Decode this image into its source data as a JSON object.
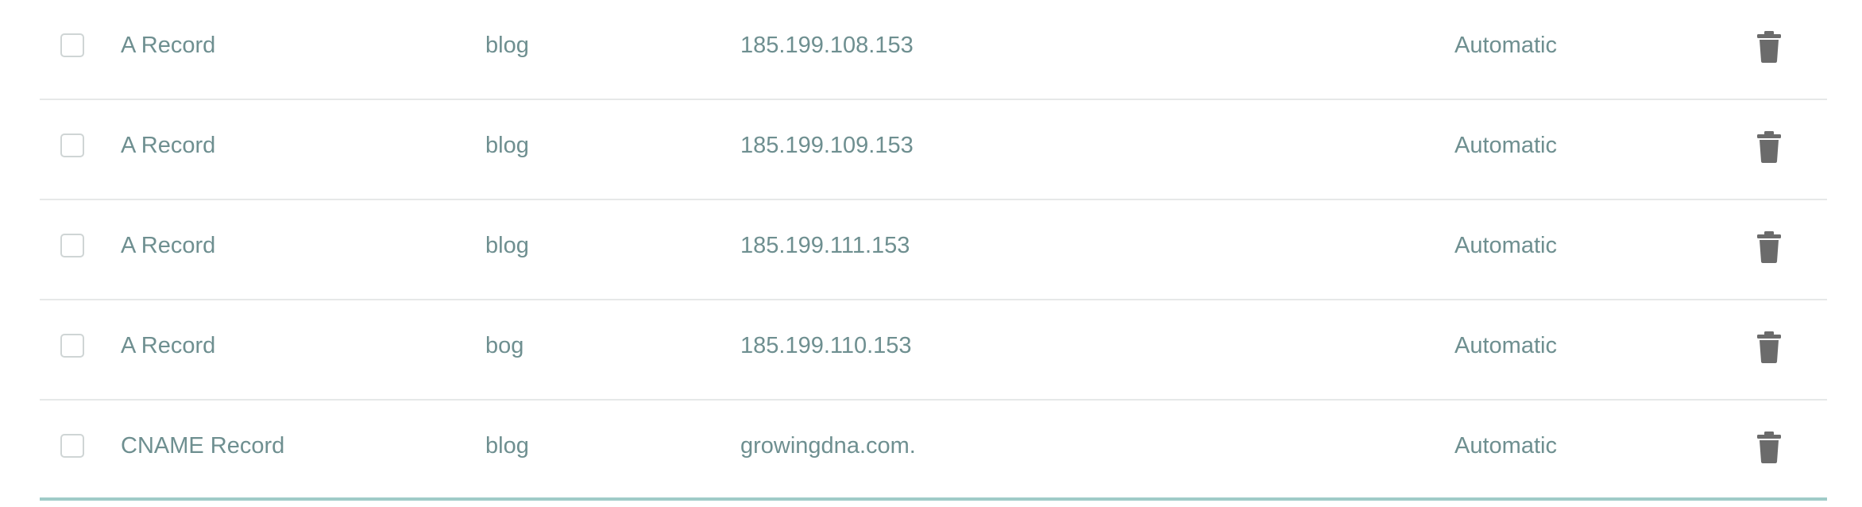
{
  "colors": {
    "text": "#6e8f90",
    "row_divider": "#e6e8e8",
    "table_bottom_border": "#9fcbc8",
    "trash_icon": "#6b6b6b",
    "checkbox_border": "#cfd5d5"
  },
  "records": [
    {
      "type": "A Record",
      "name": "blog",
      "value": "185.199.108.153",
      "ttl": "Automatic",
      "delete_icon": "trash-icon"
    },
    {
      "type": "A Record",
      "name": "blog",
      "value": "185.199.109.153",
      "ttl": "Automatic",
      "delete_icon": "trash-icon"
    },
    {
      "type": "A Record",
      "name": "blog",
      "value": "185.199.111.153",
      "ttl": "Automatic",
      "delete_icon": "trash-icon"
    },
    {
      "type": "A Record",
      "name": "bog",
      "value": "185.199.110.153",
      "ttl": "Automatic",
      "delete_icon": "trash-icon"
    },
    {
      "type": "CNAME Record",
      "name": "blog",
      "value": "growingdna.com.",
      "ttl": "Automatic",
      "delete_icon": "trash-icon"
    }
  ]
}
